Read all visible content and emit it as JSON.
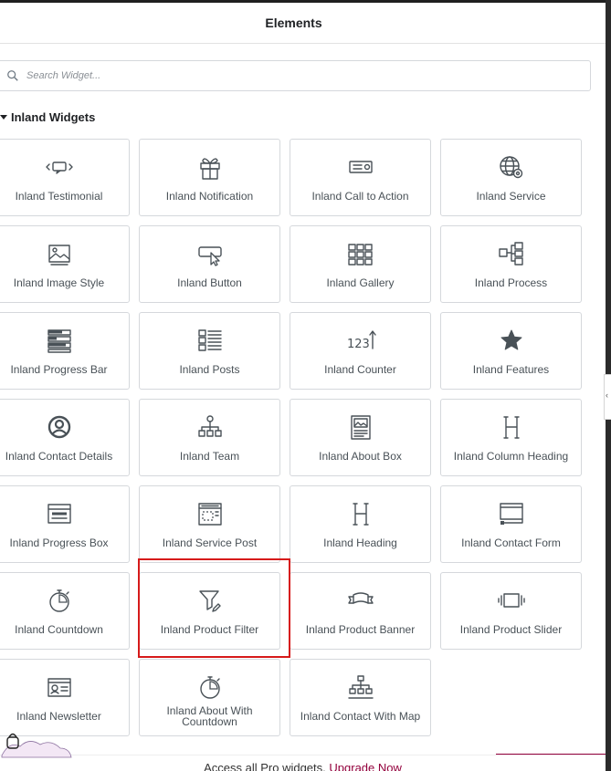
{
  "header": {
    "title": "Elements"
  },
  "search": {
    "placeholder": "Search Widget..."
  },
  "section": {
    "title": "Inland Widgets"
  },
  "widgets": [
    {
      "label": "Inland Testimonial",
      "icon": "testimonial-icon"
    },
    {
      "label": "Inland Notification",
      "icon": "gift-icon"
    },
    {
      "label": "Inland Call to Action",
      "icon": "call-to-action-icon"
    },
    {
      "label": "Inland Service",
      "icon": "globe-gear-icon"
    },
    {
      "label": "Inland Image Style",
      "icon": "image-icon"
    },
    {
      "label": "Inland Button",
      "icon": "button-cursor-icon"
    },
    {
      "label": "Inland Gallery",
      "icon": "gallery-grid-icon"
    },
    {
      "label": "Inland Process",
      "icon": "process-flow-icon"
    },
    {
      "label": "Inland Progress Bar",
      "icon": "progress-bars-icon"
    },
    {
      "label": "Inland Posts",
      "icon": "posts-list-icon"
    },
    {
      "label": "Inland Counter",
      "icon": "counter-123-icon"
    },
    {
      "label": "Inland Features",
      "icon": "star-icon"
    },
    {
      "label": "Inland Contact Details",
      "icon": "user-circle-icon"
    },
    {
      "label": "Inland Team",
      "icon": "team-tree-icon"
    },
    {
      "label": "Inland About Box",
      "icon": "about-box-icon"
    },
    {
      "label": "Inland Column Heading",
      "icon": "heading-h-icon"
    },
    {
      "label": "Inland Progress Box",
      "icon": "progress-box-icon"
    },
    {
      "label": "Inland Service Post",
      "icon": "service-post-icon"
    },
    {
      "label": "Inland Heading",
      "icon": "heading-h-icon"
    },
    {
      "label": "Inland Contact Form",
      "icon": "contact-form-icon"
    },
    {
      "label": "Inland Countdown",
      "icon": "stopwatch-icon"
    },
    {
      "label": "Inland Product Filter",
      "icon": "filter-funnel-icon"
    },
    {
      "label": "Inland Product Banner",
      "icon": "banner-ribbon-icon"
    },
    {
      "label": "Inland Product Slider",
      "icon": "slider-icon"
    },
    {
      "label": "Inland Newsletter",
      "icon": "newsletter-id-icon"
    },
    {
      "label": "Inland About With Countdown",
      "icon": "stopwatch-icon"
    },
    {
      "label": "Inland Contact With Map",
      "icon": "sitemap-icon"
    }
  ],
  "promo": {
    "text": "Access all Pro widgets.",
    "link": "Upgrade Now"
  },
  "edge_tab": {
    "glyph": "‹"
  },
  "colors": {
    "highlight": "#d61a1a",
    "accent": "#93003c",
    "icon": "#495157"
  }
}
